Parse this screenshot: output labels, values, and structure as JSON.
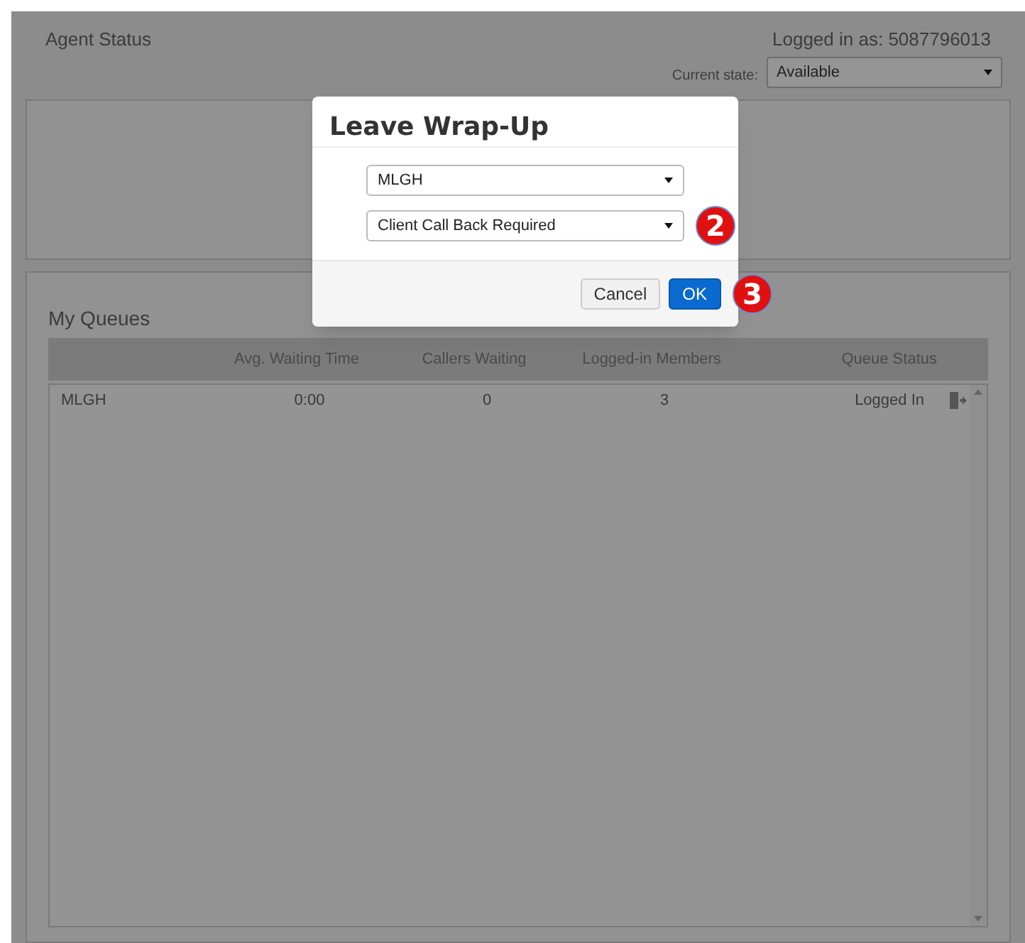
{
  "header": {
    "title": "Agent Status",
    "logged_in": "Logged in as: 5087796013",
    "state_label": "Current state:",
    "state_value": "Available"
  },
  "queues": {
    "title": "My Queues",
    "columns": [
      "Avg. Waiting Time",
      "Callers Waiting",
      "Logged-in Members",
      "Queue Status"
    ],
    "rows": [
      {
        "name": "MLGH",
        "avg_wait": "0:00",
        "callers": "0",
        "members": "3",
        "status": "Logged In"
      }
    ]
  },
  "dialog": {
    "title": "Leave Wrap-Up",
    "selects": [
      {
        "value": "MLGH"
      },
      {
        "value": "Client Call Back Required",
        "badge": "2"
      }
    ],
    "buttons": [
      {
        "label": "Cancel",
        "kind": "default"
      },
      {
        "label": "OK",
        "kind": "primary",
        "badge": "3"
      }
    ]
  }
}
